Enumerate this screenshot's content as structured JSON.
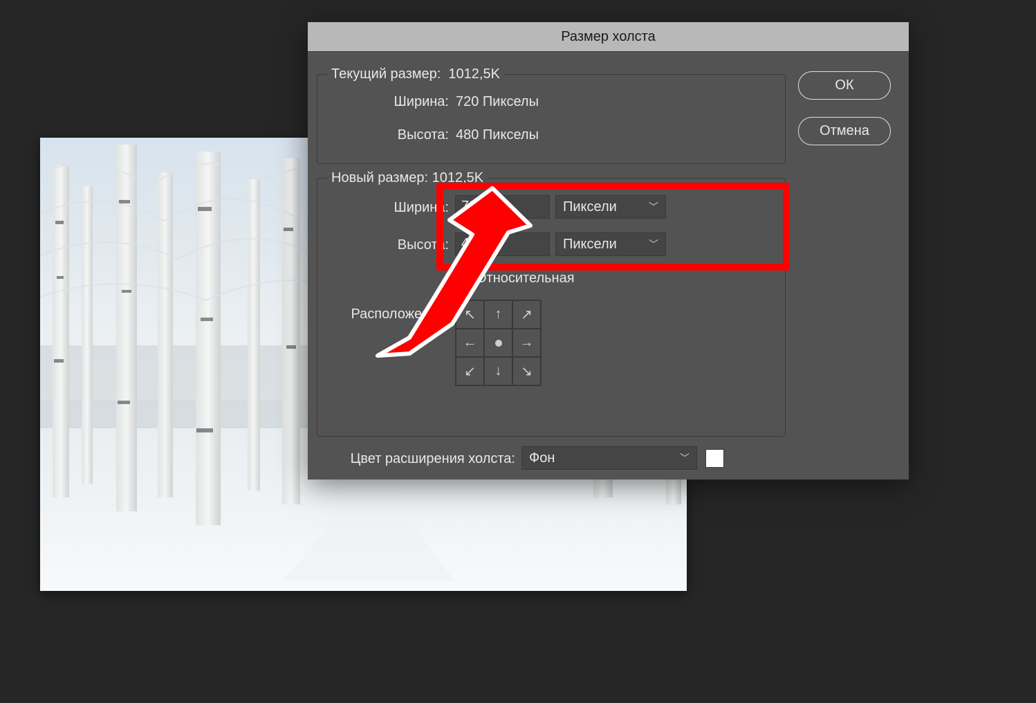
{
  "dialog": {
    "title": "Размер холста",
    "current": {
      "legend_prefix": "Текущий размер:",
      "size_value": "1012,5K",
      "width_label": "Ширина:",
      "width_value": "720 Пикселы",
      "height_label": "Высота:",
      "height_value": "480 Пикселы"
    },
    "new": {
      "legend_prefix": "Новый размер:",
      "size_value": "1012,5K",
      "width_label": "Ширина:",
      "width_value": "720",
      "width_unit": "Пиксели",
      "height_label": "Высота:",
      "height_value": "480",
      "height_unit": "Пиксели",
      "relative_label": "Относительная",
      "anchor_label": "Расположение:"
    },
    "extension_color_label": "Цвет расширения холста:",
    "extension_color_value": "Фон",
    "buttons": {
      "ok": "ОК",
      "cancel": "Отмена"
    }
  }
}
